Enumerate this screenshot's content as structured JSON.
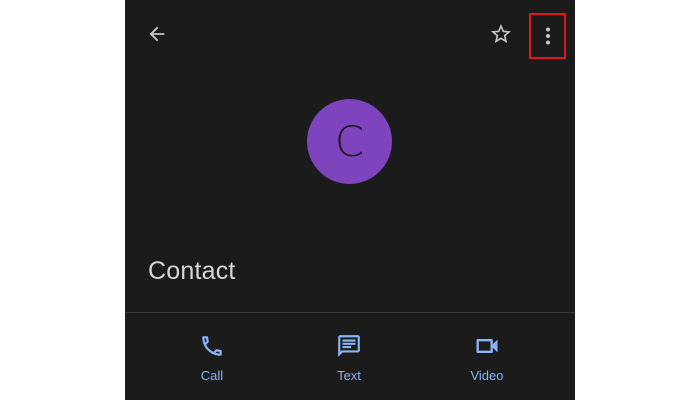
{
  "header": {
    "back_icon": "arrow-back-icon",
    "star_icon": "star-outline-icon",
    "more_icon": "more-vert-icon"
  },
  "contact": {
    "initial": "C",
    "name": "Contact",
    "avatar_color": "#7d44bd",
    "avatar_text_color": "#1b1b1c"
  },
  "actions": {
    "call_label": "Call",
    "text_label": "Text",
    "video_label": "Video",
    "icon_color": "#8ab4f8"
  },
  "colors": {
    "background": "#1b1b1c",
    "header_icon": "#c8c8cc",
    "highlight": "#e3171b"
  }
}
